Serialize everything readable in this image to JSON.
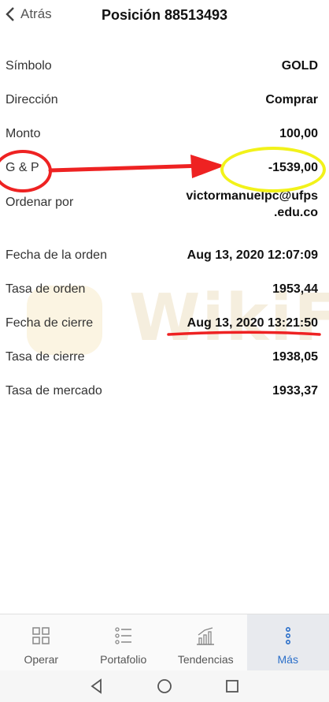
{
  "header": {
    "back_label": "Atrás",
    "title": "Posición 88513493"
  },
  "details": [
    {
      "label": "Símbolo",
      "value": "GOLD"
    },
    {
      "label": "Dirección",
      "value": "Comprar"
    },
    {
      "label": "Monto",
      "value": "100,00"
    },
    {
      "label": "G & P",
      "value": "-1539,00"
    },
    {
      "label": "Ordenar por",
      "value_line1": "victormanuelpc@ufps",
      "value_line2": ".edu.co"
    },
    {
      "label": "Fecha de la orden",
      "value": "Aug 13, 2020 12:07:09"
    },
    {
      "label": "Tasa de orden",
      "value": "1953,44"
    },
    {
      "label": "Fecha de cierre",
      "value": "Aug 13, 2020 13:21:50"
    },
    {
      "label": "Tasa de cierre",
      "value": "1938,05"
    },
    {
      "label": "Tasa de mercado",
      "value": "1933,37"
    }
  ],
  "watermark": "WikiFX",
  "tabs": [
    {
      "label": "Operar",
      "icon": "grid-icon"
    },
    {
      "label": "Portafolio",
      "icon": "list-icon"
    },
    {
      "label": "Tendencias",
      "icon": "chart-icon"
    },
    {
      "label": "Más",
      "icon": "more-icon",
      "active": true
    }
  ],
  "colors": {
    "accent": "#2b6fc9",
    "annotation_red": "#e22222",
    "annotation_yellow": "#f2f21a"
  }
}
